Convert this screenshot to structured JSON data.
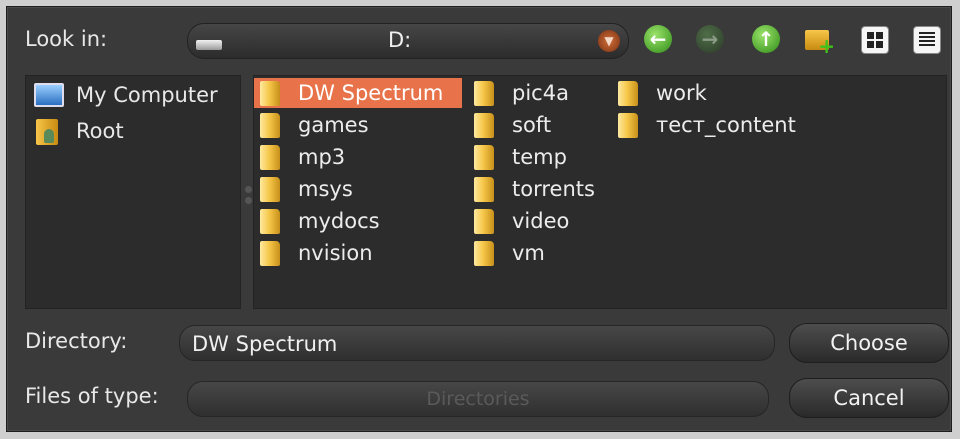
{
  "toolbar": {
    "look_in_label": "Look in:",
    "location_value": "D:",
    "back_icon": "arrow-left-icon",
    "forward_icon": "arrow-right-icon",
    "up_icon": "arrow-up-icon",
    "new_folder_icon": "new-folder-icon",
    "icon_view_icon": "grid-view-icon",
    "list_view_icon": "list-view-icon"
  },
  "sidebar": {
    "items": [
      {
        "label": "My Computer",
        "icon": "computer-icon"
      },
      {
        "label": "Root",
        "icon": "user-folder-icon"
      }
    ]
  },
  "files": {
    "selected": "DW Spectrum",
    "items": [
      {
        "name": "DW Spectrum"
      },
      {
        "name": "games"
      },
      {
        "name": "mp3"
      },
      {
        "name": "msys"
      },
      {
        "name": "mydocs"
      },
      {
        "name": "nvision"
      },
      {
        "name": "pic4a"
      },
      {
        "name": "soft"
      },
      {
        "name": "temp"
      },
      {
        "name": "torrents"
      },
      {
        "name": "video"
      },
      {
        "name": "vm"
      },
      {
        "name": "work"
      },
      {
        "name": "тест_content"
      }
    ]
  },
  "form": {
    "directory_label": "Directory:",
    "directory_value": "DW Spectrum",
    "files_of_type_label": "Files of type:",
    "files_of_type_value": "Directories"
  },
  "buttons": {
    "choose": "Choose",
    "cancel": "Cancel"
  },
  "colors": {
    "background": "#3a3a3a",
    "selection": "#e8734a",
    "nav_green": "#4caf2a"
  }
}
